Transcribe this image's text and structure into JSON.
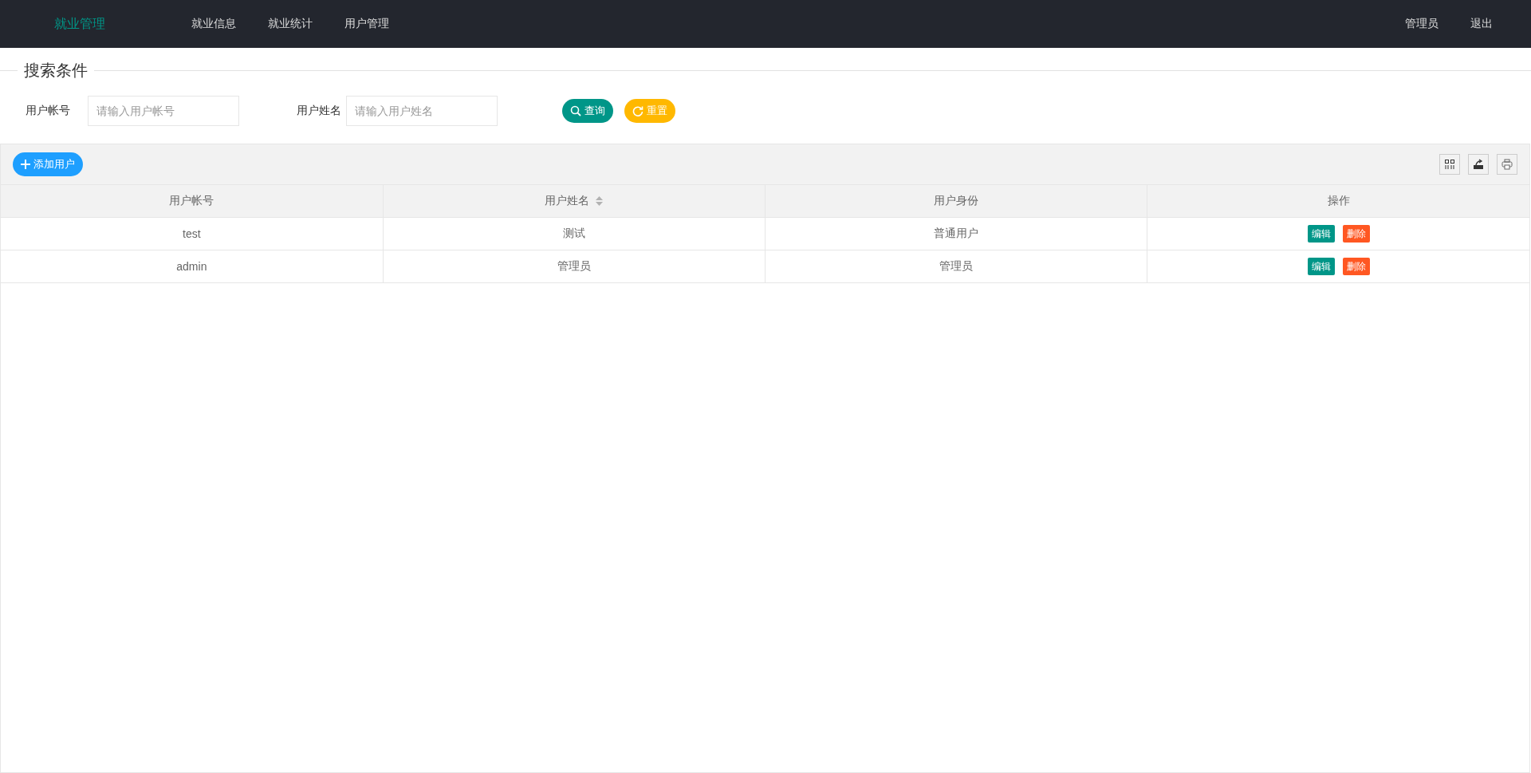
{
  "header": {
    "logo": "就业管理",
    "nav": [
      {
        "label": "就业信息"
      },
      {
        "label": "就业统计"
      },
      {
        "label": "用户管理"
      }
    ],
    "user": "管理员",
    "logout": "退出"
  },
  "search": {
    "legend": "搜索条件",
    "fields": [
      {
        "label": "用户帐号",
        "placeholder": "请输入用户帐号"
      },
      {
        "label": "用户姓名",
        "placeholder": "请输入用户姓名"
      }
    ],
    "buttons": [
      {
        "label": "查询",
        "kind": "search"
      },
      {
        "label": "重置",
        "kind": "reset"
      }
    ]
  },
  "toolbar": {
    "add_button": "添加用户"
  },
  "table": {
    "columns": [
      {
        "label": "用户帐号",
        "sortable": false
      },
      {
        "label": "用户姓名",
        "sortable": true
      },
      {
        "label": "用户身份",
        "sortable": false
      },
      {
        "label": "操作",
        "sortable": false
      }
    ],
    "rows": [
      {
        "cells": [
          "test",
          "测试",
          "普通用户"
        ],
        "actions": [
          {
            "label": "编辑",
            "kind": "edit"
          },
          {
            "label": "删除",
            "kind": "delete"
          }
        ]
      },
      {
        "cells": [
          "admin",
          "管理员",
          "管理员"
        ],
        "actions": [
          {
            "label": "编辑",
            "kind": "edit"
          },
          {
            "label": "删除",
            "kind": "delete"
          }
        ]
      }
    ]
  }
}
